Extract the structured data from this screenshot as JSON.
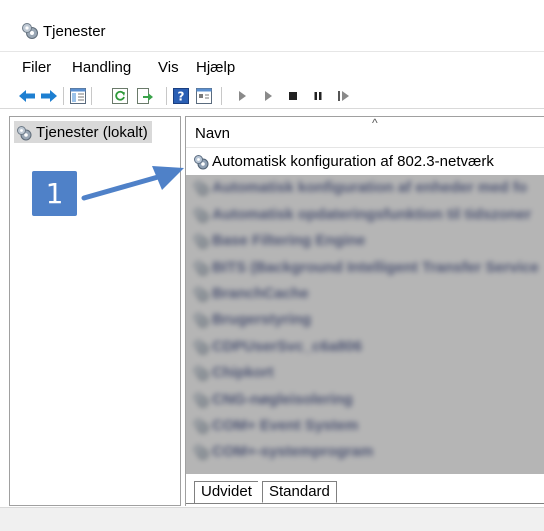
{
  "window": {
    "title": "Tjenester",
    "icon": "services-gear-icon"
  },
  "menubar": {
    "items": [
      "Filer",
      "Handling",
      "Vis",
      "Hjælp"
    ]
  },
  "toolbar": {
    "buttons": [
      "back-arrow-icon",
      "forward-arrow-icon",
      "show-hide-tree-icon",
      "refresh-icon",
      "export-list-icon",
      "help-icon",
      "properties-icon",
      "start-service-icon",
      "start-service-alt-icon",
      "stop-service-icon",
      "pause-service-icon",
      "restart-service-icon"
    ]
  },
  "tree": {
    "items": [
      {
        "label": "Tjenester (lokalt)",
        "selected": true
      }
    ]
  },
  "list": {
    "column_header": "Navn",
    "sort_indicator": "^",
    "rows": [
      {
        "name": "Automatisk konfiguration af 802.3-netværk",
        "blurred": false
      },
      {
        "name": "Automatisk konfiguration af enheder med fo",
        "blurred": true
      },
      {
        "name": "Automatisk opdateringsfunktion til tidszoner",
        "blurred": true
      },
      {
        "name": "Base Filtering Engine",
        "blurred": true
      },
      {
        "name": "BITS (Background Intelligent Transfer Service",
        "blurred": true
      },
      {
        "name": "BranchCache",
        "blurred": true
      },
      {
        "name": "Brugerstyring",
        "blurred": true
      },
      {
        "name": "CDPUserSvc_c6a806",
        "blurred": true
      },
      {
        "name": "Chipkort",
        "blurred": true
      },
      {
        "name": "CNG-nøgleisolering",
        "blurred": true
      },
      {
        "name": "COM+ Event System",
        "blurred": true
      },
      {
        "name": "COM+-systemprogram",
        "blurred": true
      }
    ]
  },
  "tabs": [
    {
      "label": "Udvidet"
    },
    {
      "label": "Standard",
      "active": true
    }
  ],
  "annotation": {
    "number": "1",
    "color": "#4f81c8"
  }
}
